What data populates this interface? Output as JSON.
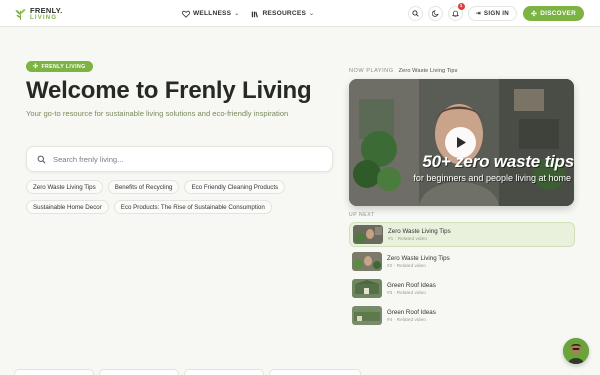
{
  "brand": {
    "name_top": "FRENLY.",
    "name_bottom": "LIVING",
    "accent": "#7cb342"
  },
  "nav": {
    "items": [
      {
        "label": "WELLNESS",
        "icon": "heart-icon"
      },
      {
        "label": "RESOURCES",
        "icon": "library-icon"
      }
    ]
  },
  "header": {
    "notification_count": "1",
    "signin_label": "SIGN IN",
    "discover_label": "DISCOVER"
  },
  "hero": {
    "badge": "FRENLY LIVING",
    "title": "Welcome to Frenly Living",
    "subtitle": "Your go-to resource for sustainable living solutions and eco-friendly inspiration"
  },
  "search": {
    "placeholder": "Search frenly living..."
  },
  "suggestions": {
    "row1": [
      "Zero Waste Living Tips",
      "Benefits of Recycling",
      "Eco Friendly Cleaning Products"
    ],
    "row2": [
      "Sustainable Home Decor",
      "Eco Products: The Rise of Sustainable Consumption"
    ]
  },
  "player": {
    "now_playing_label": "NOW PLAYING",
    "now_playing_title": "Zero Waste Living Tips",
    "video_title_overlay": "50+ zero waste tips",
    "video_subtitle_overlay": "for beginners and people living at home"
  },
  "up_next": {
    "label": "UP NEXT",
    "items": [
      {
        "title": "Zero Waste Living Tips",
        "meta": "#1 · Related video"
      },
      {
        "title": "Zero Waste Living Tips",
        "meta": "#2 · Related video"
      },
      {
        "title": "Green Roof Ideas",
        "meta": "#3 · Related video"
      },
      {
        "title": "Green Roof Ideas",
        "meta": "#4 · Related video"
      }
    ]
  }
}
